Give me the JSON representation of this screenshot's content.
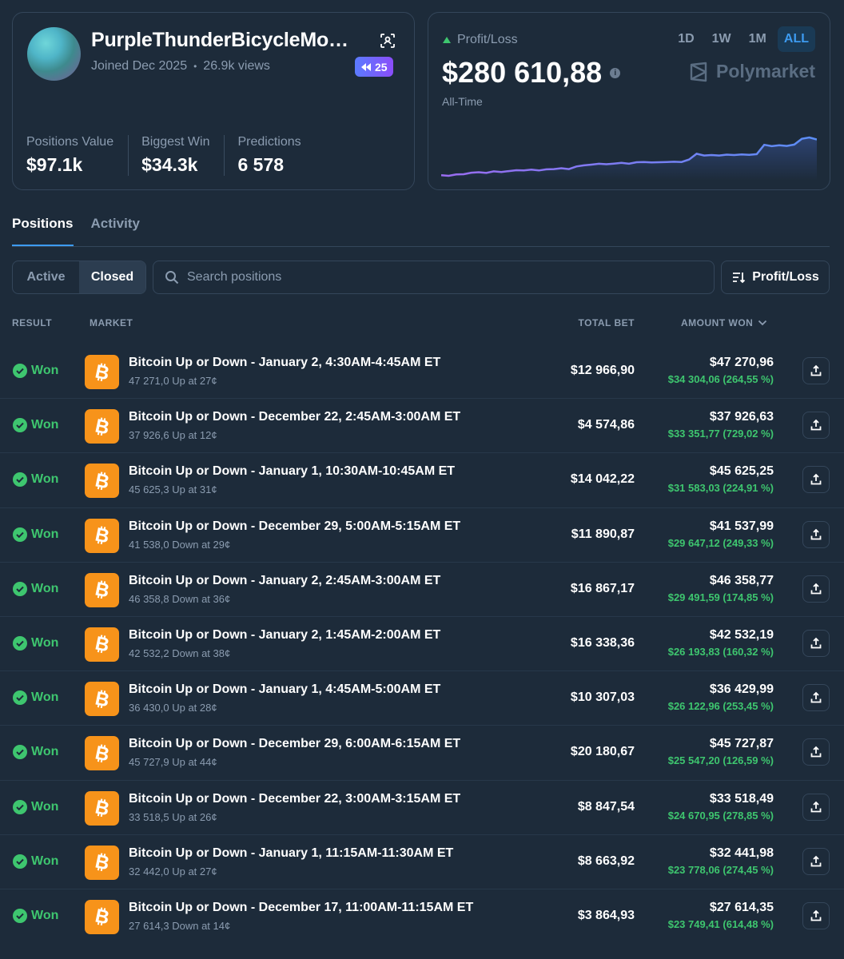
{
  "profile": {
    "username": "PurpleThunderBicycleMo…",
    "joined": "Joined Dec 2025",
    "views": "26.9k views",
    "badge_count": "25",
    "stats": [
      {
        "label": "Positions Value",
        "value": "$97.1k"
      },
      {
        "label": "Biggest Win",
        "value": "$34.3k"
      },
      {
        "label": "Predictions",
        "value": "6 578"
      }
    ]
  },
  "pnl": {
    "label": "Profit/Loss",
    "value": "$280 610,88",
    "period": "All-Time",
    "brand": "Polymarket",
    "timeframes": [
      "1D",
      "1W",
      "1M",
      "ALL"
    ],
    "active_timeframe": "ALL",
    "line_color": "#8b6cf5",
    "sparkline_values": [
      0.5,
      0.2,
      0.8,
      0.9,
      1.6,
      1.8,
      1.5,
      2.2,
      1.9,
      2.3,
      2.7,
      2.6,
      3.0,
      2.6,
      3.1,
      3.2,
      3.6,
      3.2,
      4.4,
      4.9,
      5.2,
      5.6,
      5.4,
      5.7,
      6.0,
      5.6,
      6.3,
      6.4,
      6.2,
      6.3,
      6.4,
      6.5,
      6.4,
      7.5,
      10.1,
      9.3,
      9.5,
      9.3,
      9.7,
      9.5,
      9.8,
      9.6,
      9.9,
      14.1,
      13.5,
      13.9,
      13.6,
      14.2,
      16.8,
      17.4,
      16.5
    ]
  },
  "tabs": [
    {
      "label": "Positions",
      "active": true
    },
    {
      "label": "Activity",
      "active": false
    }
  ],
  "filters": {
    "active_label": "Active",
    "closed_label": "Closed",
    "search_placeholder": "Search positions",
    "sort_label": "Profit/Loss"
  },
  "table": {
    "headers": {
      "result": "RESULT",
      "market": "MARKET",
      "total_bet": "TOTAL BET",
      "amount_won": "AMOUNT WON"
    },
    "rows": [
      {
        "result": "Won",
        "title": "Bitcoin Up or Down - January 2, 4:30AM-4:45AM ET",
        "sub": "47 271,0 Up at 27¢",
        "bet": "$12 966,90",
        "won": "$47 270,96",
        "profit": "$34 304,06 (264,55 %)"
      },
      {
        "result": "Won",
        "title": "Bitcoin Up or Down - December 22, 2:45AM-3:00AM ET",
        "sub": "37 926,6 Up at 12¢",
        "bet": "$4 574,86",
        "won": "$37 926,63",
        "profit": "$33 351,77 (729,02 %)"
      },
      {
        "result": "Won",
        "title": "Bitcoin Up or Down - January 1, 10:30AM-10:45AM ET",
        "sub": "45 625,3 Up at 31¢",
        "bet": "$14 042,22",
        "won": "$45 625,25",
        "profit": "$31 583,03 (224,91 %)"
      },
      {
        "result": "Won",
        "title": "Bitcoin Up or Down - December 29, 5:00AM-5:15AM ET",
        "sub": "41 538,0 Down at 29¢",
        "bet": "$11 890,87",
        "won": "$41 537,99",
        "profit": "$29 647,12 (249,33 %)"
      },
      {
        "result": "Won",
        "title": "Bitcoin Up or Down - January 2, 2:45AM-3:00AM ET",
        "sub": "46 358,8 Down at 36¢",
        "bet": "$16 867,17",
        "won": "$46 358,77",
        "profit": "$29 491,59 (174,85 %)"
      },
      {
        "result": "Won",
        "title": "Bitcoin Up or Down - January 2, 1:45AM-2:00AM ET",
        "sub": "42 532,2 Down at 38¢",
        "bet": "$16 338,36",
        "won": "$42 532,19",
        "profit": "$26 193,83 (160,32 %)"
      },
      {
        "result": "Won",
        "title": "Bitcoin Up or Down - January 1, 4:45AM-5:00AM ET",
        "sub": "36 430,0 Up at 28¢",
        "bet": "$10 307,03",
        "won": "$36 429,99",
        "profit": "$26 122,96 (253,45 %)"
      },
      {
        "result": "Won",
        "title": "Bitcoin Up or Down - December 29, 6:00AM-6:15AM ET",
        "sub": "45 727,9 Up at 44¢",
        "bet": "$20 180,67",
        "won": "$45 727,87",
        "profit": "$25 547,20 (126,59 %)"
      },
      {
        "result": "Won",
        "title": "Bitcoin Up or Down - December 22, 3:00AM-3:15AM ET",
        "sub": "33 518,5 Up at 26¢",
        "bet": "$8 847,54",
        "won": "$33 518,49",
        "profit": "$24 670,95 (278,85 %)"
      },
      {
        "result": "Won",
        "title": "Bitcoin Up or Down - January 1, 11:15AM-11:30AM ET",
        "sub": "32 442,0 Up at 27¢",
        "bet": "$8 663,92",
        "won": "$32 441,98",
        "profit": "$23 778,06 (274,45 %)"
      },
      {
        "result": "Won",
        "title": "Bitcoin Up or Down - December 17, 11:00AM-11:15AM ET",
        "sub": "27 614,3 Down at 14¢",
        "bet": "$3 864,93",
        "won": "$27 614,35",
        "profit": "$23 749,41 (614,48 %)"
      }
    ]
  }
}
